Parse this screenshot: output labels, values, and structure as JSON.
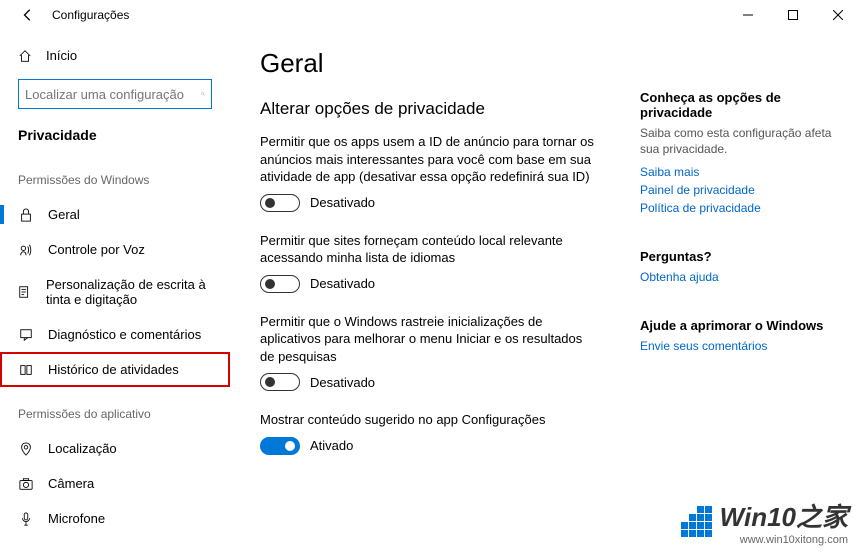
{
  "window": {
    "title": "Configurações"
  },
  "sidebar": {
    "home": "Início",
    "search_placeholder": "Localizar uma configuração",
    "heading": "Privacidade",
    "section1_label": "Permissões do Windows",
    "items1": [
      {
        "label": "Geral"
      },
      {
        "label": "Controle por Voz"
      },
      {
        "label": "Personalização de escrita à tinta e digitação"
      },
      {
        "label": "Diagnóstico e comentários"
      },
      {
        "label": "Histórico de atividades"
      }
    ],
    "section2_label": "Permissões do aplicativo",
    "items2": [
      {
        "label": "Localização"
      },
      {
        "label": "Câmera"
      },
      {
        "label": "Microfone"
      }
    ]
  },
  "main": {
    "title": "Geral",
    "subheading": "Alterar opções de privacidade",
    "options": [
      {
        "desc": "Permitir que os apps usem a ID de anúncio para tornar os anúncios mais interessantes para você com base em sua atividade de app (desativar essa opção redefinirá sua ID)",
        "state_label": "Desativado",
        "on": false
      },
      {
        "desc": "Permitir que sites forneçam conteúdo local relevante acessando minha lista de idiomas",
        "state_label": "Desativado",
        "on": false
      },
      {
        "desc": "Permitir que o Windows rastreie inicializações de aplicativos para melhorar o menu Iniciar e os resultados de pesquisas",
        "state_label": "Desativado",
        "on": false
      },
      {
        "desc": "Mostrar conteúdo sugerido no app Configurações",
        "state_label": "Ativado",
        "on": true
      }
    ]
  },
  "right": {
    "g1_heading": "Conheça as opções de privacidade",
    "g1_text": "Saiba como esta configuração afeta sua privacidade.",
    "g1_links": [
      "Saiba mais",
      "Painel de privacidade",
      "Política de privacidade"
    ],
    "g2_heading": "Perguntas?",
    "g2_links": [
      "Obtenha ajuda"
    ],
    "g3_heading": "Ajude a aprimorar o Windows",
    "g3_links": [
      "Envie seus comentários"
    ]
  },
  "watermark": {
    "text": "Win10之家",
    "url": "www.win10xitong.com"
  }
}
